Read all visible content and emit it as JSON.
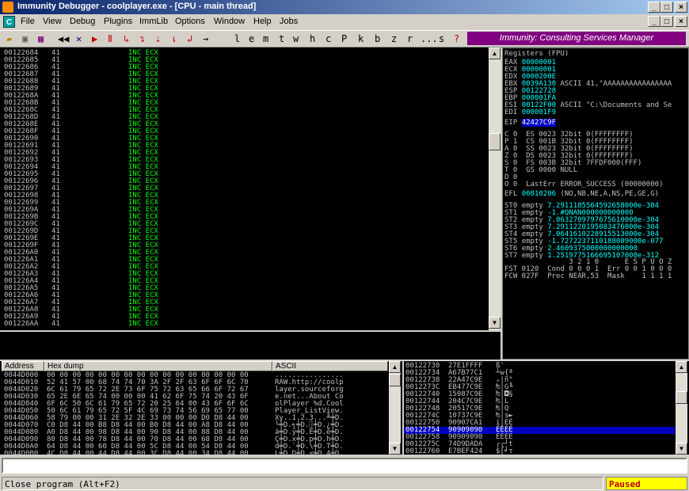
{
  "window": {
    "title": "Immunity Debugger - coolplayer.exe - [CPU - main thread]"
  },
  "menu": [
    "File",
    "View",
    "Debug",
    "Plugins",
    "ImmLib",
    "Options",
    "Window",
    "Help",
    "Jobs"
  ],
  "toolbar": {
    "letters": [
      "l",
      "e",
      "m",
      "t",
      "w",
      "h",
      "c",
      "P",
      "k",
      "b",
      "z",
      "r",
      "...",
      "s",
      "?"
    ],
    "banner": "Immunity: Consulting Services Manager"
  },
  "cpu_rows": [
    [
      "00122684",
      "41",
      "INC ECX"
    ],
    [
      "00122685",
      "41",
      "INC ECX"
    ],
    [
      "00122686",
      "41",
      "INC ECX"
    ],
    [
      "00122687",
      "41",
      "INC ECX"
    ],
    [
      "00122688",
      "41",
      "INC ECX"
    ],
    [
      "00122689",
      "41",
      "INC ECX"
    ],
    [
      "0012268A",
      "41",
      "INC ECX"
    ],
    [
      "0012268B",
      "41",
      "INC ECX"
    ],
    [
      "0012268C",
      "41",
      "INC ECX"
    ],
    [
      "0012268D",
      "41",
      "INC ECX"
    ],
    [
      "0012268E",
      "41",
      "INC ECX"
    ],
    [
      "0012268F",
      "41",
      "INC ECX"
    ],
    [
      "00122690",
      "41",
      "INC ECX"
    ],
    [
      "00122691",
      "41",
      "INC ECX"
    ],
    [
      "00122692",
      "41",
      "INC ECX"
    ],
    [
      "00122693",
      "41",
      "INC ECX"
    ],
    [
      "00122694",
      "41",
      "INC ECX"
    ],
    [
      "00122695",
      "41",
      "INC ECX"
    ],
    [
      "00122696",
      "41",
      "INC ECX"
    ],
    [
      "00122697",
      "41",
      "INC ECX"
    ],
    [
      "00122698",
      "41",
      "INC ECX"
    ],
    [
      "00122699",
      "41",
      "INC ECX"
    ],
    [
      "0012269A",
      "41",
      "INC ECX"
    ],
    [
      "0012269B",
      "41",
      "INC ECX"
    ],
    [
      "0012269C",
      "41",
      "INC ECX"
    ],
    [
      "0012269D",
      "41",
      "INC ECX"
    ],
    [
      "0012269E",
      "41",
      "INC ECX"
    ],
    [
      "0012269F",
      "41",
      "INC ECX"
    ],
    [
      "001226A0",
      "41",
      "INC ECX"
    ],
    [
      "001226A1",
      "41",
      "INC ECX"
    ],
    [
      "001226A2",
      "41",
      "INC ECX"
    ],
    [
      "001226A3",
      "41",
      "INC ECX"
    ],
    [
      "001226A4",
      "41",
      "INC ECX"
    ],
    [
      "001226A5",
      "41",
      "INC ECX"
    ],
    [
      "001226A6",
      "41",
      "INC ECX"
    ],
    [
      "001226A7",
      "41",
      "INC ECX"
    ],
    [
      "001226A8",
      "41",
      "INC ECX"
    ],
    [
      "001226A9",
      "41",
      "INC ECX"
    ],
    [
      "001226AA",
      "41",
      "INC ECX"
    ]
  ],
  "registers": {
    "header": "Registers (FPU)",
    "gp": [
      [
        "EAX",
        "00000001",
        ""
      ],
      [
        "ECX",
        "00000001",
        ""
      ],
      [
        "EDX",
        "0000200E",
        ""
      ],
      [
        "EBX",
        "0039A130",
        "ASCII 41,\"AAAAAAAAAAAAAAAA"
      ],
      [
        "ESP",
        "00122728",
        ""
      ],
      [
        "EBP",
        "000001FA",
        ""
      ],
      [
        "ESI",
        "00122F00",
        "ASCII \"C:\\Documents and Se"
      ],
      [
        "EDI",
        "000001F9",
        ""
      ]
    ],
    "eip_label": "EIP",
    "eip_value": "42427C9F",
    "flags": [
      "C 0  ES 0023 32bit 0(FFFFFFFF)",
      "P 1  CS 001B 32bit 0(FFFFFFFF)",
      "A 0  SS 0023 32bit 0(FFFFFFFF)",
      "Z 0  DS 0023 32bit 0(FFFFFFFF)",
      "S 0  FS 003B 32bit 7FFDF000(FFF)",
      "T 0  GS 0000 NULL",
      "D 0",
      "O 0  LastErr ERROR_SUCCESS (00000000)"
    ],
    "efl_label": "EFL",
    "efl_value": "00010206",
    "efl_text": "(NO,NB,NE,A,NS,PE,GE,G)",
    "fpu": [
      [
        "ST0",
        "empty",
        "7.2911185564592658000e-304"
      ],
      [
        "ST1",
        "empty",
        "-1.#QNAN000000000000"
      ],
      [
        "ST2",
        "empty",
        "7.0632709797675610000e-304"
      ],
      [
        "ST3",
        "empty",
        "7.2911220195083476000e-304"
      ],
      [
        "ST4",
        "empty",
        "7.0641610228915513000e-304"
      ],
      [
        "ST5",
        "empty",
        "-1.7272237110188089000e-077"
      ],
      [
        "ST6",
        "empty",
        "2.4609375000000000000"
      ],
      [
        "ST7",
        "empty",
        "1.2519775166695107000e-312"
      ]
    ],
    "fpu_header1": "               3 2 1 0      E S P U O Z",
    "fst_line": "FST 0120  Cond 0 0 0 1  Err 0 0 1 0 0 0",
    "fcw_line": "FCW 027F  Prec NEAR,53  Mask    1 1 1 1"
  },
  "dump": {
    "col_address": "Address",
    "col_hex": "Hex dump",
    "col_ascii": "ASCII",
    "rows": [
      [
        "0044D000",
        "00 00 00 00 00 00 00 00 00 00 00 00 00 00 00 00",
        "................"
      ],
      [
        "0044D010",
        "52 41 57 00 68 74 74 70 3A 2F 2F 63 6F 6F 6C 70",
        "RAW.http://coolp"
      ],
      [
        "0044D020",
        "6C 61 79 65 72 2E 73 6F 75 72 63 65 66 6F 72 67",
        "layer.sourceforg"
      ],
      [
        "0044D030",
        "65 2E 6E 65 74 00 00 00 41 62 6F 75 74 20 43 6F",
        "e.net...About Co"
      ],
      [
        "0044D040",
        "6F 6C 50 6C 61 79 65 72 20 25 64 00 43 6F 6F 6C",
        "olPlayer %d.Cool"
      ],
      [
        "0044D050",
        "50 6C 61 79 65 72 5F 4C 69 73 74 56 69 65 77 00",
        "Player_ListView."
      ],
      [
        "0044D060",
        "58 79 00 00 31 2E 32 2E 33 00 00 00 D0 D8 44 00",
        "Xy..1.2.3...╨╪D."
      ],
      [
        "0044D070",
        "C0 D8 44 00 B8 D8 44 00 B0 D8 44 00 A8 D8 44 00",
        "└╪D.╕╪D.░╪D.¿╪D."
      ],
      [
        "0044D080",
        "A0 D8 44 00 98 D8 44 00 90 D8 44 00 88 D8 44 00",
        "á╪D.ÿ╪D.É╪D.ê╪D."
      ],
      [
        "0044D090",
        "80 D8 44 00 78 D8 44 00 70 D8 44 00 68 D8 44 00",
        "Ç╪D.x╪D.p╪D.h╪D."
      ],
      [
        "0044D0A0",
        "64 D8 44 00 60 D8 44 00 5C D8 44 00 54 D8 44 00",
        "d╪D.`╪D.\\╪D.T╪D."
      ],
      [
        "0044D0B0",
        "4C D8 44 00 44 D8 44 00 3C D8 44 00 34 D8 44 00",
        "L╪D.D╪D.<╪D.4╪D."
      ]
    ]
  },
  "stack": {
    "rows": [
      [
        "00122730",
        "27E1FFFF",
        "ß'"
      ],
      [
        "00122734",
        "A67B77C1",
        "┴w{ª"
      ],
      [
        "00122738",
        "22A47C9E",
        "ₓ|ñ\""
      ],
      [
        "0012273C",
        "EB477C9E",
        "₧|G╙"
      ],
      [
        "00122740",
        "15087C9E",
        "₧|◘§"
      ],
      [
        "00122744",
        "204C7C9E",
        "₧|L "
      ],
      [
        "00122748",
        "20517C9E",
        "₧|Q "
      ],
      [
        "0012274C",
        "10737C9E",
        "₧|s►"
      ],
      [
        "00122750",
        "90907CA1",
        "í|ÉÉ"
      ],
      [
        "00122754",
        "90909090",
        "ÉÉÉÉ"
      ],
      [
        "00122758",
        "90909090",
        "ÉÉÉÉ"
      ],
      [
        "0012275C",
        "74D9DADA",
        "┌┌┘t"
      ],
      [
        "00122760",
        "E7BEF424",
        "$⌠╛τ"
      ]
    ],
    "selected_index": 9
  },
  "status": {
    "message": "Close program (Alt+F2)",
    "state": "Paused"
  }
}
